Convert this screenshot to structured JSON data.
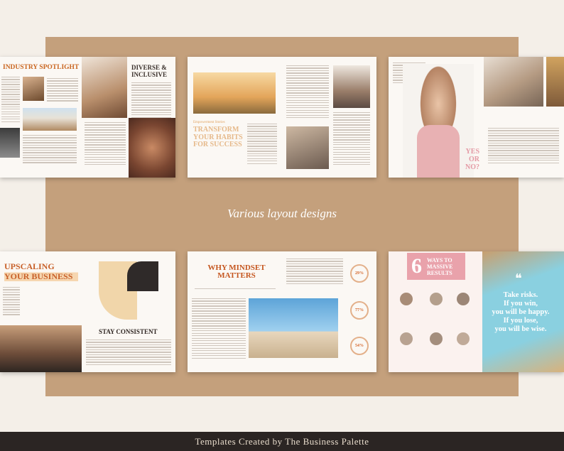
{
  "caption": "Various layout designs",
  "footer": "Templates Created by The Business Palette",
  "spreads": {
    "s1": {
      "title": "INDUSTRY SPOTLIGHT",
      "feature_title": "DIVERSE & INCLUSIVE"
    },
    "s2": {
      "sub": "Empowerment Stories",
      "title": "TRANSFORM YOUR HABITS FOR SUCCESS"
    },
    "s3": {
      "title": "YES OR NO?"
    },
    "s4": {
      "title": "UPSCALING YOUR BUSINESS",
      "sub_title": "STAY CONSISTENT"
    },
    "s5": {
      "title": "WHY MINDSET MATTERS",
      "stats": [
        "29%",
        "77%",
        "54%"
      ]
    },
    "s6": {
      "number": "6",
      "title": "WAYS TO MASSIVE RESULTS",
      "quote_mark": "❝",
      "quote": [
        "Take risks.",
        "If you win,",
        "you will be happy.",
        "If you lose,",
        "you will be wise."
      ]
    }
  },
  "colors": {
    "board": "#c4a07c",
    "accent": "#d4662b",
    "pink": "#e9a2ab",
    "footer_bg": "#2b2523"
  }
}
